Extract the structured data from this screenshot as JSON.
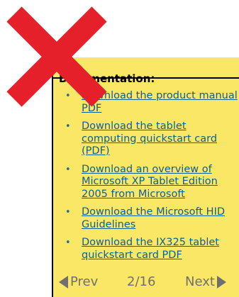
{
  "heading": "Documentation:",
  "links": [
    {
      "label": "Download the product manual PDF"
    },
    {
      "label": "Download the tablet computing quickstart card (PDF)"
    },
    {
      "label": "Download an overview of Microsoft XP Tablet Edition 2005 from Microsoft"
    },
    {
      "label": "Download the Microsoft HID Guidelines"
    },
    {
      "label": "Download the IX325 tablet quickstart card PDF"
    }
  ],
  "bullet": "•",
  "pager": {
    "prev_label": "Prev",
    "indicator": "2/16",
    "next_label": "Next"
  },
  "colors": {
    "panel_background": "#fbe766",
    "link": "#0b5f93",
    "pager_text": "#6f6f6f",
    "cross": "#e5202a"
  },
  "icons": {
    "cross": "red-x-icon",
    "prev": "triangle-left-icon",
    "next": "triangle-right-icon"
  }
}
